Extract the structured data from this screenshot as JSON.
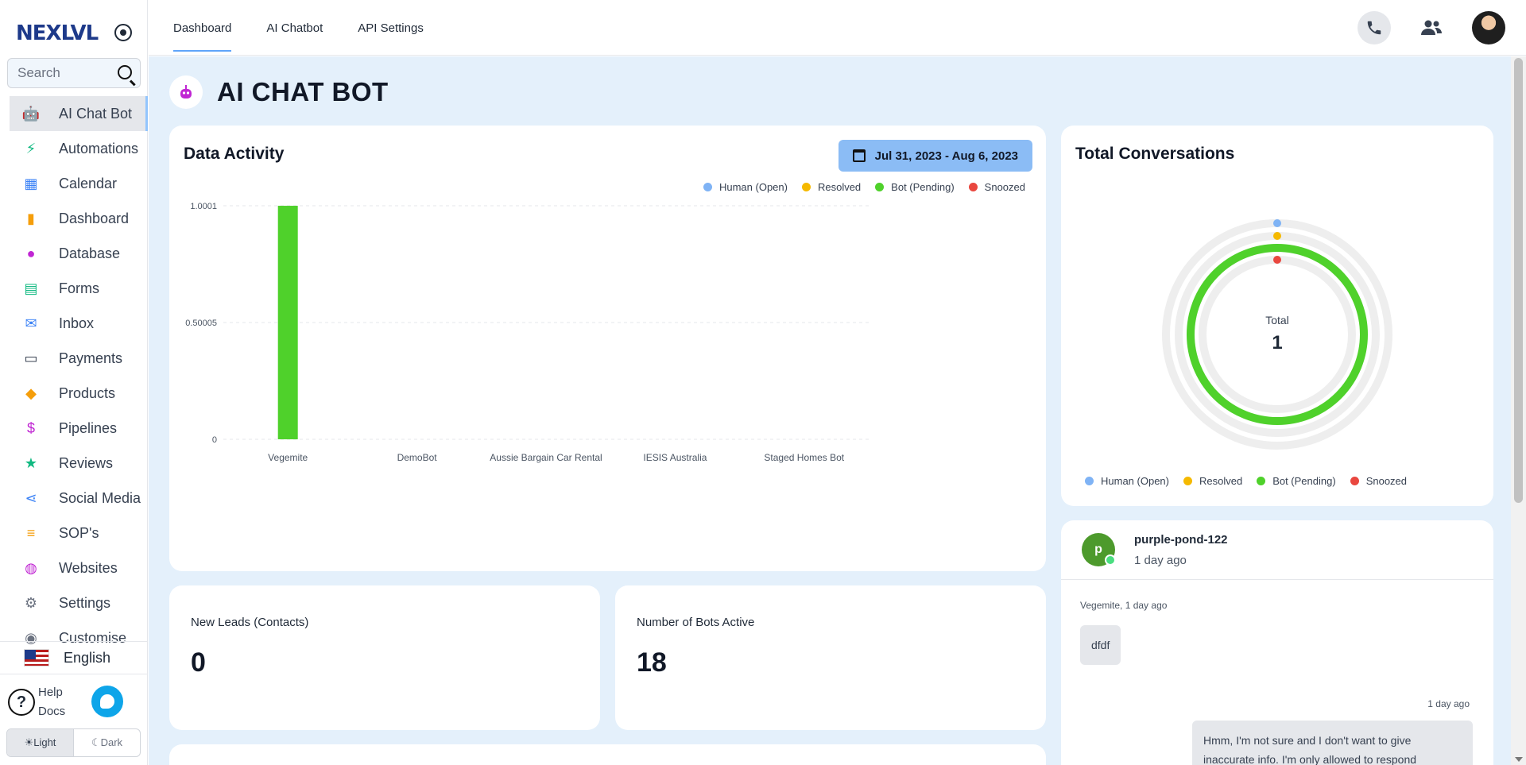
{
  "app": {
    "brand": "NEXLVL"
  },
  "sidebar": {
    "search_placeholder": "Search",
    "items": [
      {
        "label": "AI Chat Bot",
        "icon": "robot-icon",
        "color": "#c026d3",
        "active": true
      },
      {
        "label": "Automations",
        "icon": "lightning-a-icon",
        "color": "#10b981"
      },
      {
        "label": "Calendar",
        "icon": "calendar-icon",
        "color": "#3b82f6"
      },
      {
        "label": "Dashboard",
        "icon": "bar-chart-icon",
        "color": "#f59e0b"
      },
      {
        "label": "Database",
        "icon": "person-icon",
        "color": "#c026d3"
      },
      {
        "label": "Forms",
        "icon": "clipboard-icon",
        "color": "#10b981"
      },
      {
        "label": "Inbox",
        "icon": "envelope-icon",
        "color": "#3b82f6"
      },
      {
        "label": "Payments",
        "icon": "card-icon",
        "color": "#374151"
      },
      {
        "label": "Products",
        "icon": "tag-icon",
        "color": "#f59e0b"
      },
      {
        "label": "Pipelines",
        "icon": "dollar-icon",
        "color": "#c026d3"
      },
      {
        "label": "Reviews",
        "icon": "star-icon",
        "color": "#10b981"
      },
      {
        "label": "Social Media",
        "icon": "share-icon",
        "color": "#3b82f6"
      },
      {
        "label": "SOP's",
        "icon": "checklist-icon",
        "color": "#f59e0b"
      },
      {
        "label": "Websites",
        "icon": "globe-icon",
        "color": "#c026d3"
      },
      {
        "label": "Settings",
        "icon": "gear-icon",
        "color": "#6b7280"
      },
      {
        "label": "Customise",
        "icon": "palette-icon",
        "color": "#6b7280"
      }
    ],
    "language": "English",
    "help_line1": "Help",
    "help_line2": "Docs",
    "theme_light": "☀Light",
    "theme_dark": "☾Dark"
  },
  "topbar": {
    "tabs": [
      "Dashboard",
      "AI Chatbot",
      "API Settings"
    ],
    "active_tab": "Dashboard"
  },
  "page": {
    "title": "AI CHAT BOT"
  },
  "activity": {
    "title": "Data Activity",
    "date_range": "Jul 31, 2023 - Aug 6, 2023",
    "legend": [
      {
        "label": "Human (Open)",
        "color": "#7fb3f5"
      },
      {
        "label": "Resolved",
        "color": "#f5b900"
      },
      {
        "label": "Bot (Pending)",
        "color": "#4fd12b"
      },
      {
        "label": "Snoozed",
        "color": "#e9473f"
      }
    ]
  },
  "chart_data": [
    {
      "type": "bar",
      "categories": [
        "Vegemite",
        "DemoBot",
        "Aussie Bargain Car Rental",
        "IESIS Australia",
        "Staged Homes Bot"
      ],
      "series": [
        {
          "name": "Human (Open)",
          "values": [
            0,
            0,
            0,
            0,
            0
          ]
        },
        {
          "name": "Resolved",
          "values": [
            0,
            0,
            0,
            0,
            0
          ]
        },
        {
          "name": "Bot (Pending)",
          "values": [
            1,
            0,
            0,
            0,
            0
          ]
        },
        {
          "name": "Snoozed",
          "values": [
            0,
            0,
            0,
            0,
            0
          ]
        }
      ],
      "yticks": [
        "1.0001",
        "0.50005",
        "0"
      ],
      "ylim": [
        0,
        1.0001
      ],
      "grid": true,
      "legend_position": "top-right"
    },
    {
      "type": "pie",
      "title": "Total Conversations",
      "center_label": "Total",
      "center_value": "1",
      "slices": [
        {
          "name": "Human (Open)",
          "value": 0
        },
        {
          "name": "Resolved",
          "value": 0
        },
        {
          "name": "Bot (Pending)",
          "value": 1
        },
        {
          "name": "Snoozed",
          "value": 0
        }
      ],
      "legend_position": "bottom"
    }
  ],
  "stats": {
    "leads_label": "New Leads (Contacts)",
    "leads_value": "0",
    "bots_label": "Number of Bots Active",
    "bots_value": "18"
  },
  "conversation": {
    "avatar_letter": "p",
    "name": "purple-pond-122",
    "time": "1 day ago",
    "msg1_meta": "Vegemite, 1 day ago",
    "msg1_text": "dfdf",
    "msg2_meta": "1 day ago",
    "msg2_line1": "Hmm, I'm not sure and I don't want to give",
    "msg2_line2": "inaccurate info. I'm only allowed to respond"
  }
}
